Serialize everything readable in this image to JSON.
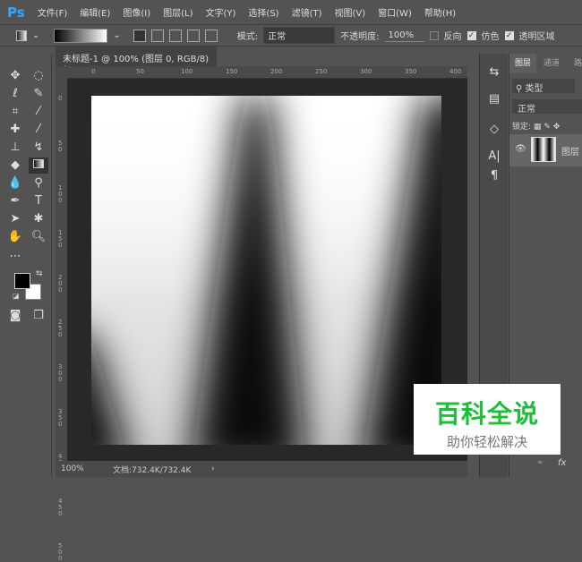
{
  "app": {
    "logo": "Ps"
  },
  "menu": [
    "文件(F)",
    "编辑(E)",
    "图像(I)",
    "图层(L)",
    "文字(Y)",
    "选择(S)",
    "滤镜(T)",
    "视图(V)",
    "窗口(W)",
    "帮助(H)"
  ],
  "options": {
    "mode_label": "模式:",
    "mode_value": "正常",
    "opacity_label": "不透明度:",
    "opacity_value": "100%",
    "reverse_label": "反向",
    "reverse_checked": false,
    "dither_label": "仿色",
    "dither_checked": true,
    "transparency_label": "透明区域",
    "transparency_checked": true
  },
  "document": {
    "tab_title": "未标题-1 @ 100% (图层 0, RGB/8) *",
    "close": "×"
  },
  "ruler": {
    "h_ticks": [
      "0",
      "50",
      "100",
      "150",
      "200",
      "250",
      "300",
      "350",
      "400",
      "450"
    ],
    "v_ticks": [
      "0",
      "50",
      "100",
      "150",
      "200",
      "250",
      "300",
      "350",
      "400",
      "450",
      "500"
    ]
  },
  "status": {
    "zoom": "100%",
    "doc_info": "文档:732.4K/732.4K",
    "arrow": "›"
  },
  "layers_panel": {
    "tabs": [
      "图层",
      "通道",
      "路"
    ],
    "filter": "类型",
    "blend": "正常",
    "lock_label": "锁定:",
    "layer_name": "图层",
    "footer": [
      "⚭",
      "fx"
    ]
  },
  "dock_icons": [
    "history-icon",
    "properties-icon",
    "paths-icon",
    "character-icon",
    "paragraph-icon"
  ],
  "watermark": {
    "title": "百科全说",
    "subtitle": "助你轻松解决",
    "color": "#1fbe3a"
  },
  "colors": {
    "foreground": "#000000",
    "background": "#ffffff"
  }
}
